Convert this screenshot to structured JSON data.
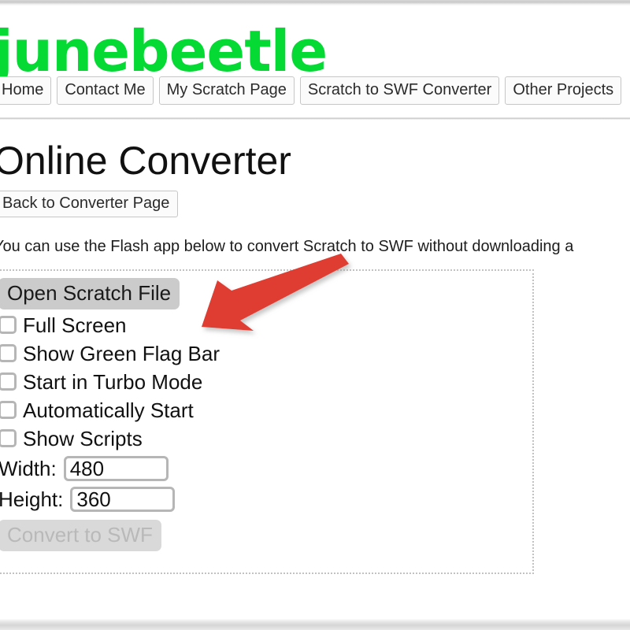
{
  "site": {
    "logo_text": "junebeetle",
    "nav": [
      {
        "label": "Home"
      },
      {
        "label": "Contact Me"
      },
      {
        "label": "My Scratch Page"
      },
      {
        "label": "Scratch to SWF Converter"
      },
      {
        "label": "Other Projects"
      }
    ]
  },
  "page": {
    "title": "Online Converter",
    "back_button": "Back to Converter Page",
    "intro": "You can use the Flash app below to convert Scratch to SWF without downloading a"
  },
  "app": {
    "open_button": "Open Scratch File",
    "options": [
      {
        "label": "Full Screen",
        "checked": false
      },
      {
        "label": "Show Green Flag Bar",
        "checked": false
      },
      {
        "label": "Start in Turbo Mode",
        "checked": false
      },
      {
        "label": "Automatically Start",
        "checked": false
      },
      {
        "label": "Show Scripts",
        "checked": false
      }
    ],
    "fields": [
      {
        "label": "Width:",
        "value": "480"
      },
      {
        "label": "Height:",
        "value": "360"
      }
    ],
    "convert_button": "Convert to SWF",
    "convert_disabled": true
  },
  "annotation": {
    "arrow_color": "#e03c31",
    "arrow_points_to": "open-scratch-file-button"
  },
  "colors": {
    "logo_green": "#05da34",
    "arrow_red": "#e03c31",
    "button_gray": "#cbcbcb",
    "disabled_gray": "#d9d9d9",
    "border_gray": "#b6b6b6",
    "dotted_border": "#c2c2c2"
  }
}
